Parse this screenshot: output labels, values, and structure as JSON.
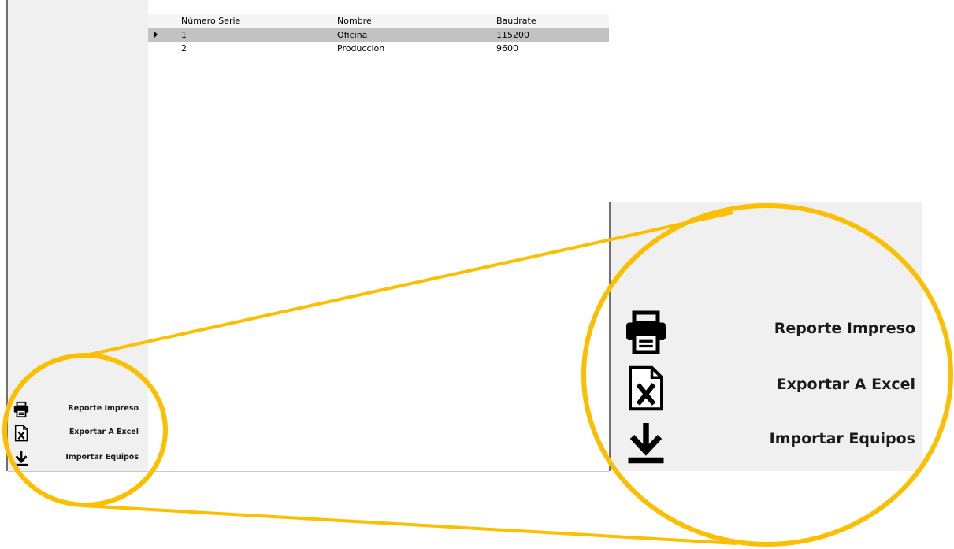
{
  "grid": {
    "columns": [
      "Número Serie",
      "Nombre",
      "Baudrate"
    ],
    "rows": [
      {
        "serie": "1",
        "nombre": "Oficina",
        "baudrate": "115200",
        "selected": true
      },
      {
        "serie": "2",
        "nombre": "Produccion",
        "baudrate": "9600",
        "selected": false
      }
    ]
  },
  "toolbar": {
    "print_label": "Reporte Impreso",
    "excel_label": "Exportar A Excel",
    "import_label": "Importar Equipos"
  },
  "icons": {
    "print": "printer-icon",
    "excel": "excel-file-icon",
    "import": "download-arrow-icon"
  },
  "colors": {
    "highlight": "#fbbf00",
    "selected_row": "#c2c2c2",
    "sidebar_bg": "#f0f0f0"
  }
}
